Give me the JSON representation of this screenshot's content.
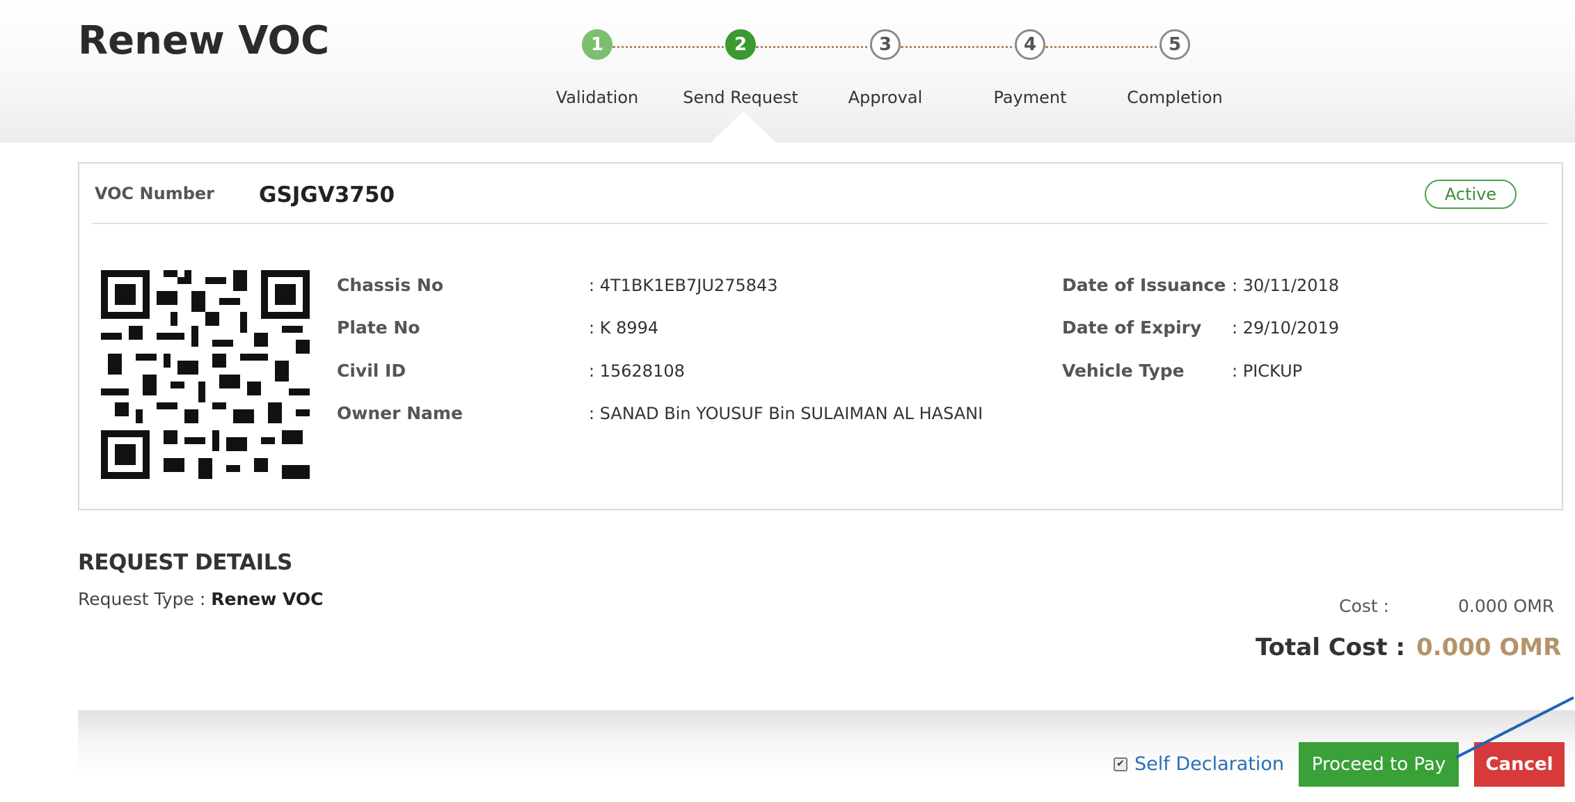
{
  "page": {
    "title": "Renew VOC"
  },
  "steps": [
    {
      "number": "1",
      "label": "Validation",
      "state": "done"
    },
    {
      "number": "2",
      "label": "Send Request",
      "state": "current"
    },
    {
      "number": "3",
      "label": "Approval",
      "state": "todo"
    },
    {
      "number": "4",
      "label": "Payment",
      "state": "todo"
    },
    {
      "number": "5",
      "label": "Completion",
      "state": "todo"
    }
  ],
  "voc": {
    "number_label": "VOC Number",
    "number": "GSJGV3750",
    "status": "Active",
    "left_fields": [
      {
        "label": "Chassis No",
        "value": ": 4T1BK1EB7JU275843"
      },
      {
        "label": "Plate No",
        "value": ": K 8994"
      },
      {
        "label": "Civil ID",
        "value": ": 15628108"
      },
      {
        "label": "Owner Name",
        "value": ": SANAD Bin YOUSUF Bin SULAIMAN AL HASANI"
      }
    ],
    "right_fields": [
      {
        "label": "Date of Issuance",
        "value": ": 30/11/2018"
      },
      {
        "label": "Date of Expiry",
        "value": ": 29/10/2019"
      },
      {
        "label": "Vehicle Type",
        "value": ": PICKUP"
      }
    ]
  },
  "request": {
    "title": "REQUEST DETAILS",
    "type_label": "Request Type :",
    "type_value": "Renew VOC",
    "cost_label": "Cost :",
    "cost_value": "0.000 OMR",
    "total_label": "Total Cost :",
    "total_value": "0.000 OMR"
  },
  "footer": {
    "self_declaration": "Self Declaration",
    "self_declaration_checked": true,
    "proceed_label": "Proceed to Pay",
    "cancel_label": "Cancel"
  },
  "colors": {
    "step_done": "#7cbf6e",
    "step_current": "#3a9a2f",
    "status_green": "#4aa04a",
    "total_accent": "#b5936a",
    "proceed_button": "#3aa038",
    "cancel_button": "#d73a3a",
    "link_blue": "#2a6fb5",
    "annotation_arrow": "#1e63b8"
  },
  "icons": {
    "qr": "qr-code-icon",
    "checkbox": "checkbox-icon"
  }
}
